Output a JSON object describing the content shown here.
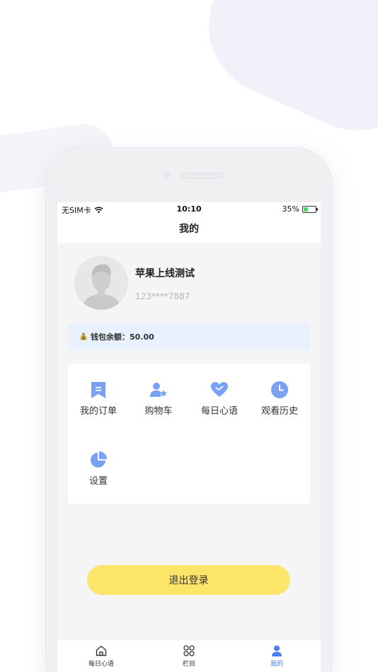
{
  "status_bar": {
    "carrier": "无SIM卡",
    "time": "10:10",
    "battery": "35%",
    "battery_level": 0.35
  },
  "nav": {
    "title": "我的"
  },
  "profile": {
    "name": "苹果上线测试",
    "phone": "123****7887"
  },
  "wallet": {
    "label": "钱包余额：50.00"
  },
  "menu": {
    "items": [
      {
        "label": "我的订单",
        "icon": "bookmark-icon"
      },
      {
        "label": "购物车",
        "icon": "user-star-icon"
      },
      {
        "label": "每日心语",
        "icon": "heart-icon"
      },
      {
        "label": "观看历史",
        "icon": "clock-icon"
      },
      {
        "label": "设置",
        "icon": "pie-chart-icon"
      }
    ]
  },
  "logout_label": "退出登录",
  "tabbar": {
    "items": [
      {
        "label": "每日心语",
        "icon": "home-icon"
      },
      {
        "label": "栏目",
        "icon": "grid-icon"
      },
      {
        "label": "我的",
        "icon": "person-icon"
      }
    ],
    "active_index": 2
  },
  "colors": {
    "accent": "#4b7ef5",
    "icon_blue": "#7aa2f4",
    "logout_yellow": "#fde56a",
    "wallet_bg": "#e8f1fd"
  }
}
